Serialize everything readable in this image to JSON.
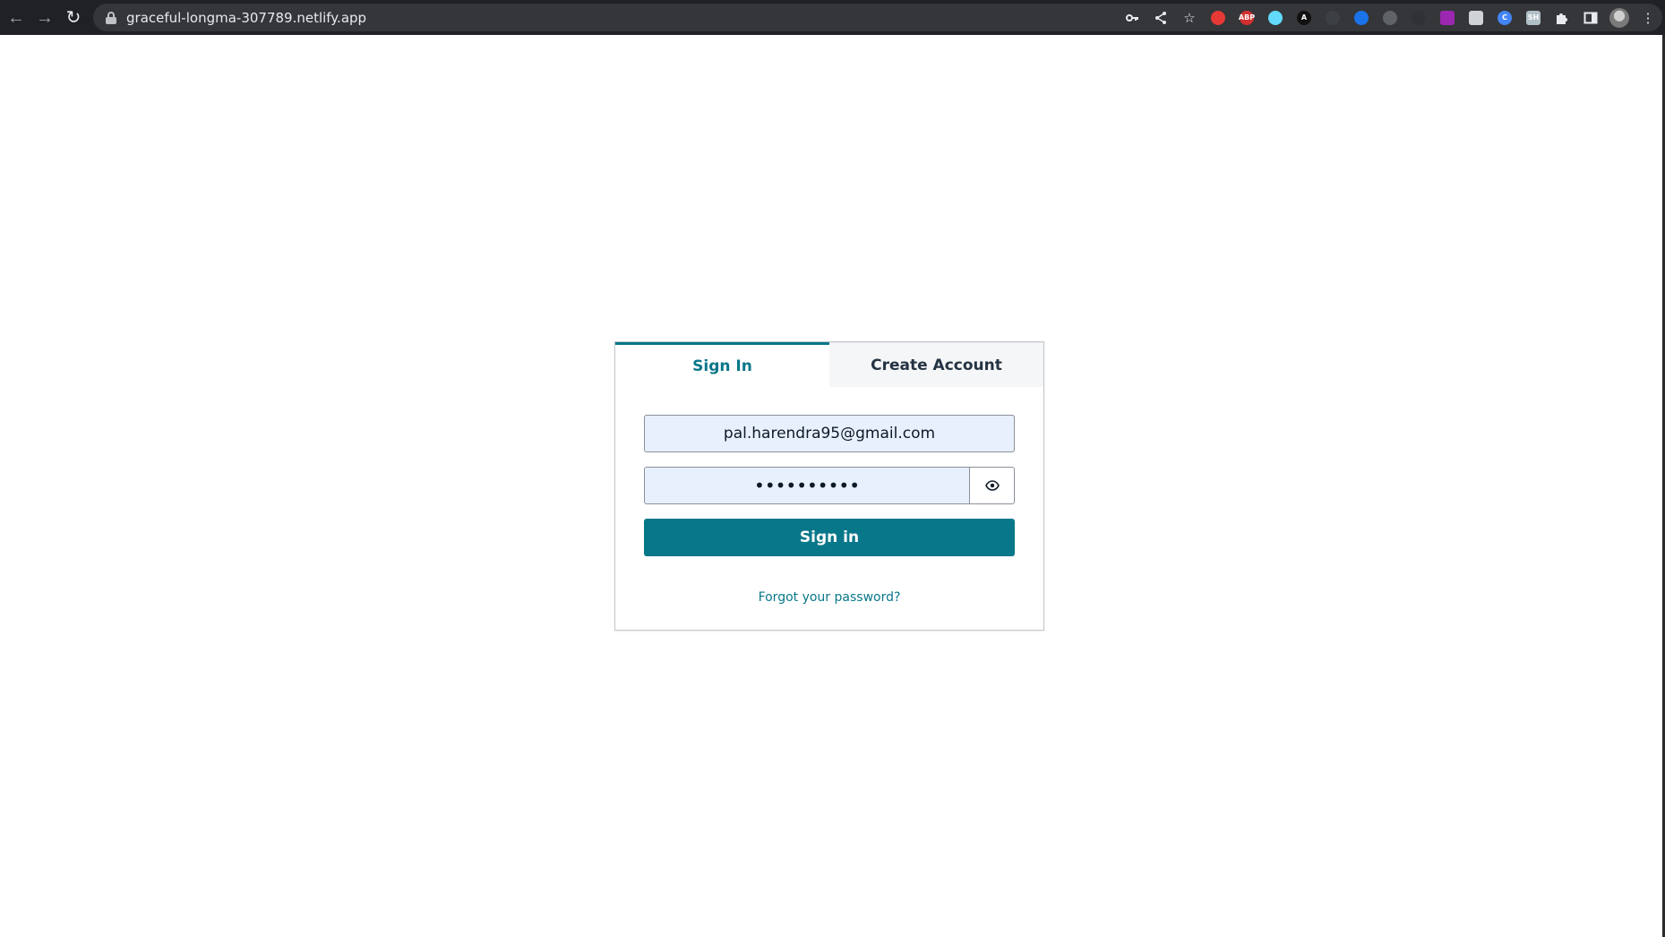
{
  "browser": {
    "url": "graceful-longma-307789.netlify.app",
    "back_icon": "arrow-left-icon",
    "forward_icon": "arrow-right-icon",
    "reload_icon": "reload-icon",
    "extensions": [
      {
        "name": "extension-red-icon",
        "color": "#e53935",
        "label": ""
      },
      {
        "name": "extension-adblock-plus-icon",
        "color": "#d32f2f",
        "label": "ABP"
      },
      {
        "name": "extension-react-icon",
        "color": "#61dafb",
        "label": ""
      },
      {
        "name": "extension-a-icon",
        "color": "#111111",
        "label": "A"
      },
      {
        "name": "extension-dark-circle-icon",
        "color": "#3c4043",
        "label": ""
      },
      {
        "name": "extension-blue-circle-icon",
        "color": "#1a73e8",
        "label": ""
      },
      {
        "name": "extension-grey-icon",
        "color": "#5f6368",
        "label": ""
      },
      {
        "name": "extension-dark-icon",
        "color": "#303134",
        "label": ""
      },
      {
        "name": "extension-colorpick-icon",
        "color": "#9c27b0",
        "label": ""
      },
      {
        "name": "extension-bitwarden-icon",
        "color": "#cfd2d6",
        "label": ""
      },
      {
        "name": "extension-c-icon",
        "color": "#4285f4",
        "label": "C"
      },
      {
        "name": "extension-sh-icon",
        "color": "#b0bec5",
        "label": "SH"
      }
    ]
  },
  "auth": {
    "tabs": [
      {
        "label": "Sign In",
        "active": true
      },
      {
        "label": "Create Account",
        "active": false
      }
    ],
    "email_value": "pal.harendra95@gmail.com",
    "password_value": "••••••••••",
    "show_password_icon": "eye-icon",
    "signin_label": "Sign in",
    "forgot_label": "Forgot your password?",
    "accent_color": "#087789"
  }
}
